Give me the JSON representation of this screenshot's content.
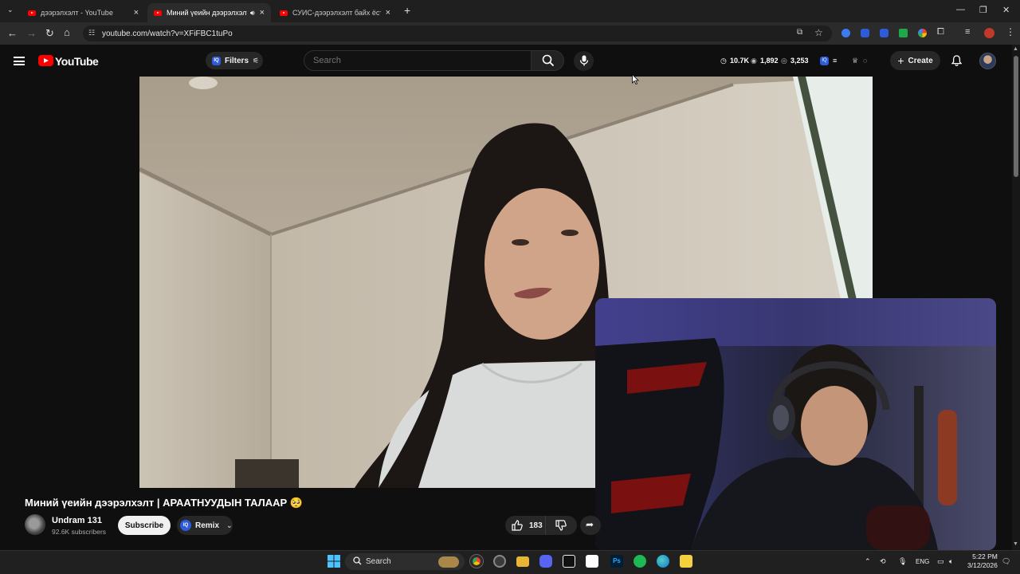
{
  "browser": {
    "tabs": [
      {
        "title": "дээрэлхэлт - YouTube",
        "active": false
      },
      {
        "title": "Миний үеийн дээрэлхэлт |",
        "active": true
      },
      {
        "title": "СУИС-дээрэлхэлт байх ёстой",
        "active": false
      }
    ],
    "new_tab_label": "+",
    "url": "youtube.com/watch?v=XFiFBC1tuPo"
  },
  "youtube": {
    "logo_text": "YouTube",
    "filters_label": "Filters",
    "search_placeholder": "Search",
    "stats": {
      "views": "10.7K",
      "watching": "1,892",
      "comments": "3,253"
    },
    "create_label": "Create"
  },
  "video": {
    "title": "Миний үеийн дээрэлхэлт | АРААТНУУДЫН ТАЛААР 🥺",
    "channel_name": "Undram 131",
    "subscribers": "92.6K subscribers",
    "subscribe_label": "Subscribe",
    "remix_label": "Remix",
    "likes": "183"
  },
  "taskbar": {
    "search_label": "Search",
    "language": "ENG",
    "time": "5:22 PM",
    "date": "3/12/2026"
  },
  "colors": {
    "youtube_red": "#ff0000",
    "background": "#0f0f0f",
    "pill": "#272727"
  }
}
